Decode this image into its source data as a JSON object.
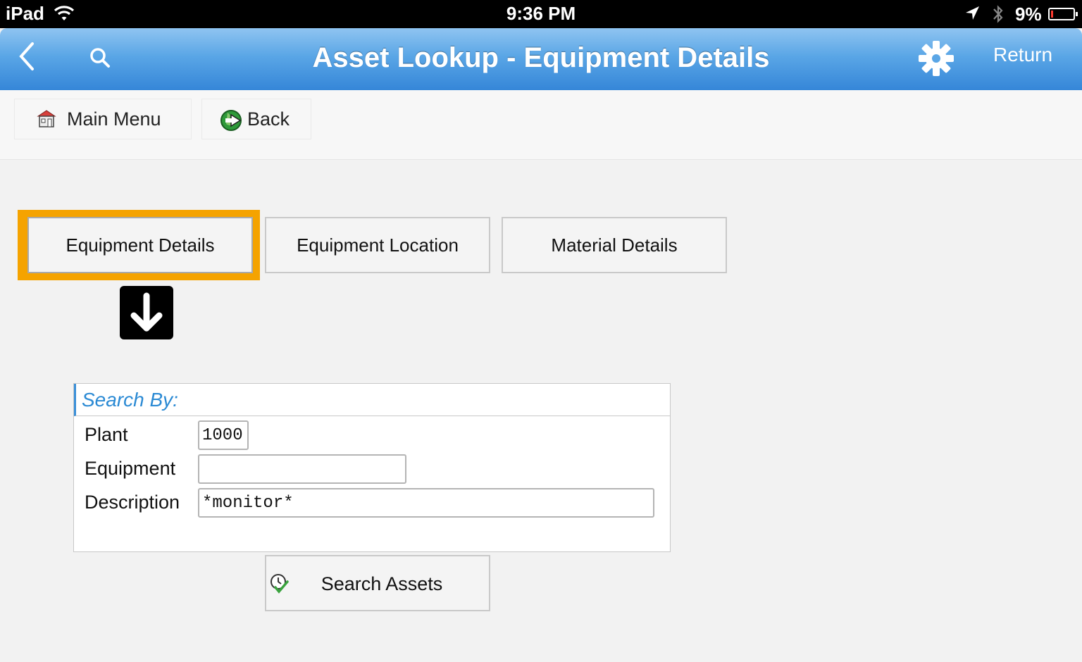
{
  "status_bar": {
    "device": "iPad",
    "time": "9:36 PM",
    "battery_percent": "9%",
    "battery_level": 0.09,
    "icons": [
      "wifi-icon",
      "location-arrow-icon",
      "bluetooth-icon",
      "battery-icon"
    ]
  },
  "nav": {
    "title": "Asset Lookup - Equipment Details",
    "return_label": "Return",
    "icons": [
      "chevron-left-icon",
      "search-icon",
      "gear-icon"
    ],
    "colors": {
      "bar_top": "#8fc4f1",
      "bar_bottom": "#3586d8"
    }
  },
  "toolbar": {
    "main_menu_label": "Main Menu",
    "back_label": "Back",
    "icons": [
      "home-icon",
      "back-arrow-icon"
    ]
  },
  "tabs": [
    {
      "label": "Equipment Details",
      "selected": true
    },
    {
      "label": "Equipment Location",
      "selected": false
    },
    {
      "label": "Material Details",
      "selected": false
    }
  ],
  "selection_color": "#f5a300",
  "search": {
    "header": "Search By:",
    "fields": [
      {
        "label": "Plant",
        "value": "1000"
      },
      {
        "label": "Equipment",
        "value": ""
      },
      {
        "label": "Description",
        "value": "*monitor*"
      }
    ],
    "button_label": "Search Assets",
    "button_icon": "clock-check-icon"
  }
}
